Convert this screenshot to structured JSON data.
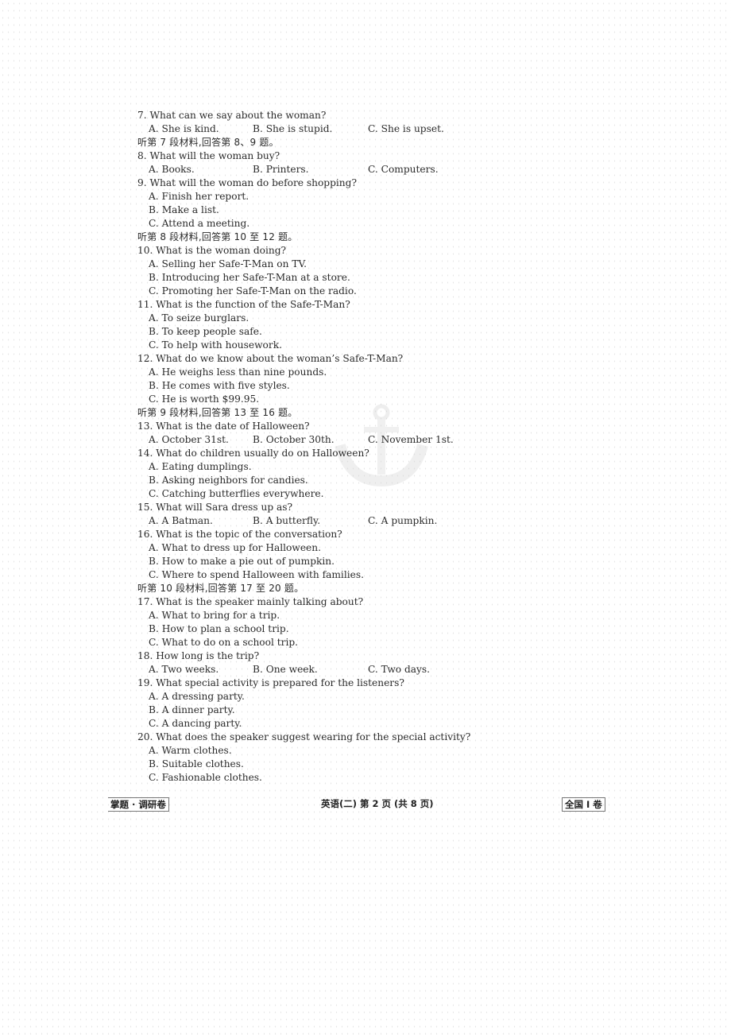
{
  "sections": [
    {
      "type": "question",
      "number": "7.",
      "text": "What can we say about the woman?",
      "layout": "row",
      "options": [
        "A. She is kind.",
        "B. She is stupid.",
        "C. She is upset."
      ]
    },
    {
      "type": "instruction",
      "text": "听第 7 段材料,回答第 8、9 题。"
    },
    {
      "type": "question",
      "number": "8.",
      "text": "What will the woman buy?",
      "layout": "row",
      "options": [
        "A. Books.",
        "B. Printers.",
        "C. Computers."
      ]
    },
    {
      "type": "question",
      "number": "9.",
      "text": "What will the woman do before shopping?",
      "layout": "column",
      "options": [
        "A. Finish her report.",
        "B. Make a list.",
        "C. Attend a meeting."
      ]
    },
    {
      "type": "instruction",
      "text": "听第 8 段材料,回答第 10 至 12 题。"
    },
    {
      "type": "question",
      "number": "10.",
      "text": "What is the woman doing?",
      "layout": "column",
      "options": [
        "A. Selling her Safe-T-Man on TV.",
        "B. Introducing her Safe-T-Man at a store.",
        "C. Promoting her Safe-T-Man on the radio."
      ]
    },
    {
      "type": "question",
      "number": "11.",
      "text": "What is the function of the Safe-T-Man?",
      "layout": "column",
      "options": [
        "A. To seize burglars.",
        "B. To keep people safe.",
        "C. To help with housework."
      ]
    },
    {
      "type": "question",
      "number": "12.",
      "text": "What do we know about the woman’s Safe-T-Man?",
      "layout": "column",
      "options": [
        "A. He weighs less than nine pounds.",
        "B. He comes with five styles.",
        "C. He is worth  $99.95."
      ]
    },
    {
      "type": "instruction",
      "text": "听第 9 段材料,回答第 13 至 16 题。"
    },
    {
      "type": "question",
      "number": "13.",
      "text": "What is the date of Halloween?",
      "layout": "row",
      "options": [
        "A. October 31st.",
        "B. October 30th.",
        "C. November 1st."
      ]
    },
    {
      "type": "question",
      "number": "14.",
      "text": "What do children usually do on Halloween?",
      "layout": "column",
      "options": [
        "A. Eating dumplings.",
        "B. Asking neighbors for candies.",
        "C. Catching butterflies everywhere."
      ]
    },
    {
      "type": "question",
      "number": "15.",
      "text": "What will Sara dress up as?",
      "layout": "row",
      "options": [
        "A. A Batman.",
        "B. A butterfly.",
        "C. A pumpkin."
      ]
    },
    {
      "type": "question",
      "number": "16.",
      "text": "What is the topic of the conversation?",
      "layout": "column",
      "options": [
        "A. What to dress up for Halloween.",
        "B. How to make a pie out of pumpkin.",
        "C. Where to spend Halloween with families."
      ]
    },
    {
      "type": "instruction",
      "text": "听第 10 段材料,回答第 17 至 20 题。"
    },
    {
      "type": "question",
      "number": "17.",
      "text": "What is the speaker mainly talking about?",
      "layout": "column",
      "options": [
        "A. What to bring for a trip.",
        "B. How to plan a school trip.",
        "C. What to do on a school trip."
      ]
    },
    {
      "type": "question",
      "number": "18.",
      "text": "How long is the trip?",
      "layout": "row",
      "options": [
        "A. Two weeks.",
        "B. One week.",
        "C. Two days."
      ]
    },
    {
      "type": "question",
      "number": "19.",
      "text": "What special activity is prepared for the listeners?",
      "layout": "column",
      "options": [
        "A. A dressing party.",
        "B. A dinner party.",
        "C. A dancing party."
      ]
    },
    {
      "type": "question",
      "number": "20.",
      "text": "What does the speaker suggest wearing for the special activity?",
      "layout": "column",
      "options": [
        "A. Warm clothes.",
        "B. Suitable clothes.",
        "C. Fashionable clothes."
      ]
    }
  ],
  "footer": {
    "left": "掌题 · 调研卷",
    "center": "英语(二) 第 2 页 (共 8 页)",
    "right": "全国 Ⅰ 卷"
  },
  "watermark": {
    "icon": "anchor-icon"
  }
}
